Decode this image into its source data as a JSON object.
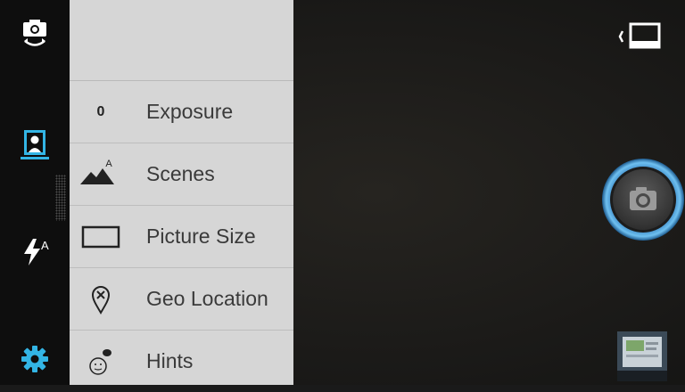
{
  "app": {
    "left_rail": {
      "icons": [
        "switch-camera-icon",
        "portrait-mode-icon",
        "flash-auto-icon",
        "settings-gear-icon"
      ],
      "accent_color": "#33b5e5",
      "flash_mode_label": "A"
    },
    "settings_menu": {
      "items": [
        {
          "label": "Exposure",
          "icon": "exposure-value",
          "value": "0"
        },
        {
          "label": "Scenes",
          "icon": "scenes-mountain-icon",
          "badge": "A"
        },
        {
          "label": "Picture Size",
          "icon": "picture-size-icon"
        },
        {
          "label": "Geo Location",
          "icon": "geo-location-icon"
        },
        {
          "label": "Hints",
          "icon": "hints-icon"
        }
      ]
    },
    "controls": {
      "shutter_icon": "camera-shutter-icon",
      "shutter_ring_color": "#4aa3df",
      "mode_toggle_icon": "fullscreen-toggle-icon",
      "thumbnail": "last-photo-thumbnail"
    }
  }
}
